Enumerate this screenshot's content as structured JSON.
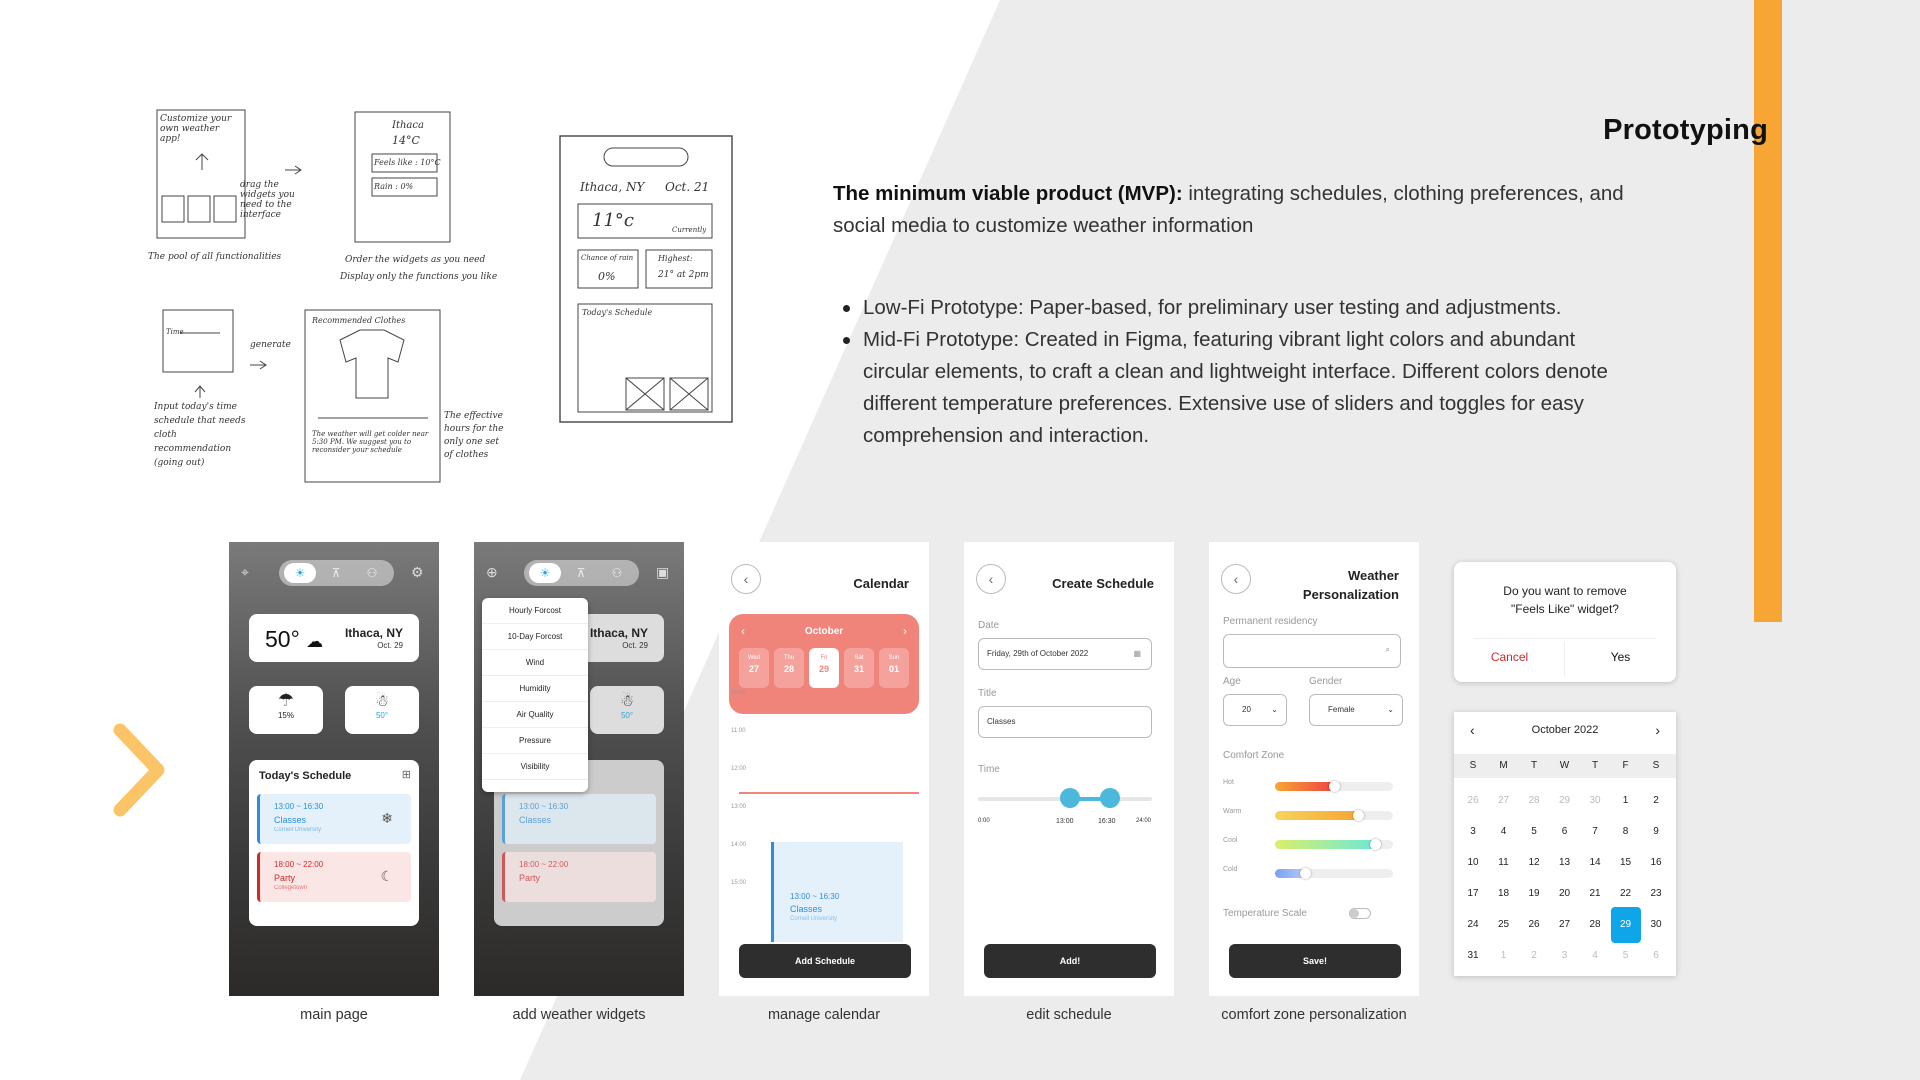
{
  "title": "Prototyping",
  "intro": {
    "bold": "The minimum viable product (MVP):",
    "text": " integrating schedules, clothing preferences, and social media to customize weather information"
  },
  "bullets": [
    "Low-Fi Prototype: Paper-based, for preliminary user testing and adjustments.",
    "Mid-Fi Prototype: Created in Figma, featuring vibrant light colors and abundant circular elements, to craft a clean and lightweight interface. Different colors denote different temperature preferences. Extensive use of sliders and toggles for easy comprehension and interaction."
  ],
  "sketch": {
    "city": "Ithaca, NY",
    "date": "Oct. 21",
    "temp": "11°c",
    "currently": "Currently",
    "rain_label": "Chance of rain",
    "rain": "0%",
    "high_label": "Highest:",
    "high": "21° at 2pm",
    "schedule": "Today's Schedule",
    "ithaca_small": "Ithaca",
    "temp_small": "14°C",
    "feels": "Feels like : 10°C",
    "rain_small": "Rain : 0%",
    "custom": "Customize your own weather app!",
    "drag": "drag the widgets you need to the interface",
    "pool": "The pool of all functionalities",
    "order": "Order the widgets as you need",
    "display": "Display only the functions you like",
    "time": "Time",
    "gen": "generate",
    "rec": "Recommended Clothes",
    "input": "Input today's time schedule that needs cloth recommendation (going out)",
    "effective": "The effective hours for the only one set of clothes",
    "note": "The weather will get colder near 5:30 PM. We suggest you to reconsider your schedule"
  },
  "screens": {
    "main": {
      "caption": "main page",
      "temp": "50°",
      "city": "Ithaca, NY",
      "date": "Oct. 29",
      "rain": "15%",
      "feels": "50°",
      "schedule_title": "Today's Schedule",
      "items": [
        {
          "time": "13:00 ~ 16:30",
          "name": "Classes",
          "sub": "Cornell University"
        },
        {
          "time": "18:00 ~ 22:00",
          "name": "Party",
          "sub": "Collegetown"
        }
      ]
    },
    "widgets": {
      "caption": "add weather widgets",
      "menu": [
        "Hourly Forcost",
        "10-Day Forcost",
        "Wind",
        "Humidity",
        "Air Quality",
        "Pressure",
        "Visibility"
      ]
    },
    "calendar": {
      "caption": "manage calendar",
      "title": "Calendar",
      "month": "October",
      "days": [
        {
          "w": "Wed",
          "d": "27"
        },
        {
          "w": "Thu",
          "d": "28"
        },
        {
          "w": "Fri",
          "d": "29"
        },
        {
          "w": "Sat",
          "d": "31"
        },
        {
          "w": "Sun",
          "d": "01"
        }
      ],
      "hours": [
        "10:00",
        "11:00",
        "12:00",
        "13:00",
        "14:00",
        "15:00"
      ],
      "event_time": "13:00 ~ 16:30",
      "event_name": "Classes",
      "event_sub": "Cornell University",
      "button": "Add Schedule"
    },
    "edit": {
      "caption": "edit schedule",
      "title": "Create Schedule",
      "date_label": "Date",
      "date_value": "Friday, 29th of October 2022",
      "title_label": "Title",
      "title_value": "Classes",
      "time_label": "Time",
      "ticks": [
        "0:00",
        "13:00",
        "16:30",
        "24:00"
      ],
      "button": "Add!"
    },
    "comfort": {
      "caption": "comfort zone personalization",
      "title1": "Weather",
      "title2": "Personalization",
      "residency": "Permanent residency",
      "age_label": "Age",
      "age": "20",
      "gender_label": "Gender",
      "gender": "Female",
      "zone": "Comfort Zone",
      "levels": [
        "Hot",
        "Warm",
        "Cool",
        "Cold"
      ],
      "scale": "Temperature Scale",
      "button": "Save!"
    }
  },
  "dialog": {
    "q1": "Do you want to remove",
    "q2": "\"Feels Like\" widget?",
    "cancel": "Cancel",
    "yes": "Yes"
  },
  "calendar_widget": {
    "month": "October 2022",
    "weekdays": [
      "S",
      "M",
      "T",
      "W",
      "T",
      "F",
      "S"
    ],
    "rows": [
      [
        "26",
        "27",
        "28",
        "29",
        "30",
        "1",
        "2"
      ],
      [
        "3",
        "4",
        "5",
        "6",
        "7",
        "8",
        "9"
      ],
      [
        "10",
        "11",
        "12",
        "13",
        "14",
        "15",
        "16"
      ],
      [
        "17",
        "18",
        "19",
        "20",
        "21",
        "22",
        "23"
      ],
      [
        "24",
        "25",
        "26",
        "27",
        "28",
        "29",
        "30"
      ],
      [
        "31",
        "1",
        "2",
        "3",
        "4",
        "5",
        "6"
      ]
    ],
    "selected": "29"
  },
  "colors": {
    "accent": "#f7a535",
    "brand_blue": "#2aa7e0",
    "salmon": "#f0837a",
    "dark_button": "#2e2e2e"
  }
}
